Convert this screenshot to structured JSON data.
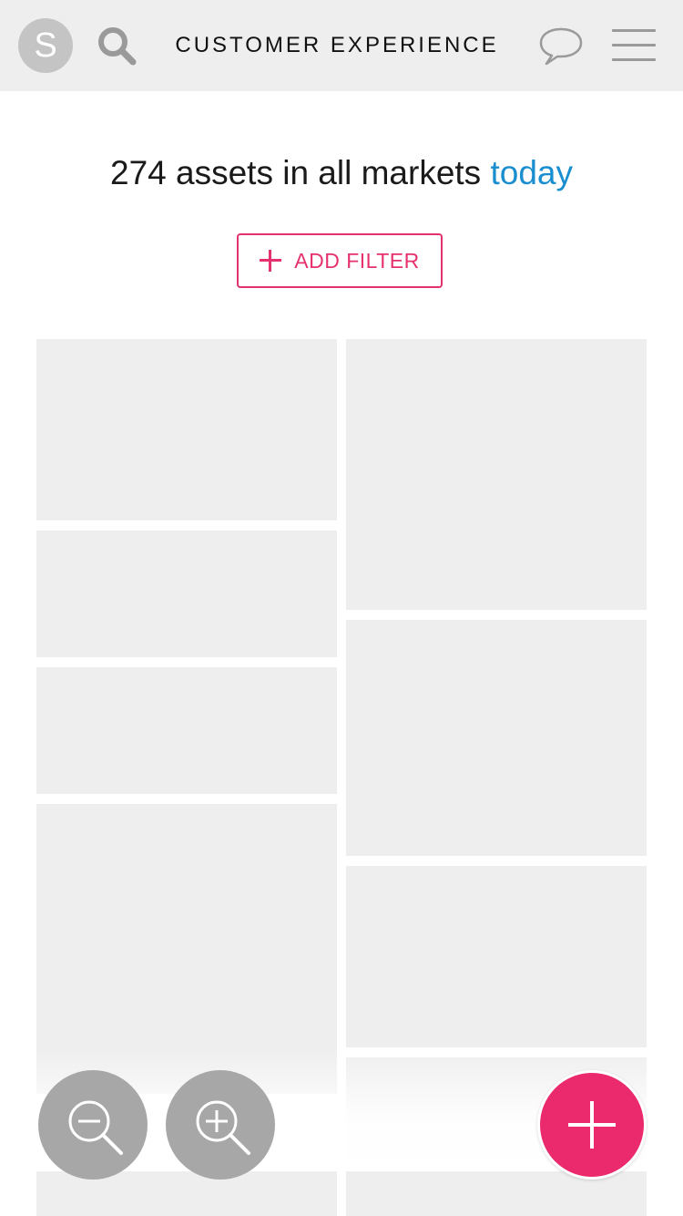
{
  "header": {
    "avatar_letter": "S",
    "title": "CUSTOMER EXPERIENCE",
    "icons": {
      "search": "search-icon",
      "chat": "chat-bubble-icon",
      "menu": "hamburger-menu-icon"
    }
  },
  "summary": {
    "text": "274 assets in all markets",
    "link": "today"
  },
  "filter": {
    "label": "ADD FILTER",
    "icon": "plus-icon"
  },
  "controls": {
    "zoom_out_icon": "zoom-out-icon",
    "zoom_in_icon": "zoom-in-icon",
    "add_icon": "plus-icon"
  },
  "colors": {
    "accent": "#e5316f",
    "link": "#1b8ecf",
    "header_bg": "#eeeeee",
    "placeholder": "#eeeeee",
    "fab": "#ea2a6d",
    "zoom_bg": "#a7a7a7"
  }
}
